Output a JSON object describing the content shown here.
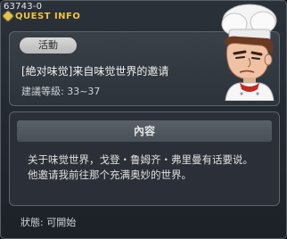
{
  "window": {
    "quest_id": "63743-0",
    "title": "QUEST INFO"
  },
  "quest": {
    "badge": "活動",
    "name": "[絶对味觉]来自味觉世界的邀请",
    "level": "建議等級: 33~37"
  },
  "content": {
    "header": "內容",
    "lines": [
      "关于味觉世界，戈登・鲁姆齐・弗里曼有话要说。",
      "他邀请我前往那个充满奥妙的世界。"
    ]
  },
  "status": "狀態: 可開始",
  "colors": {
    "title": "#f1c23c",
    "background": "#242a31"
  },
  "icons": {
    "title_marker": "star-icon",
    "npc": "chef-npc-portrait"
  }
}
